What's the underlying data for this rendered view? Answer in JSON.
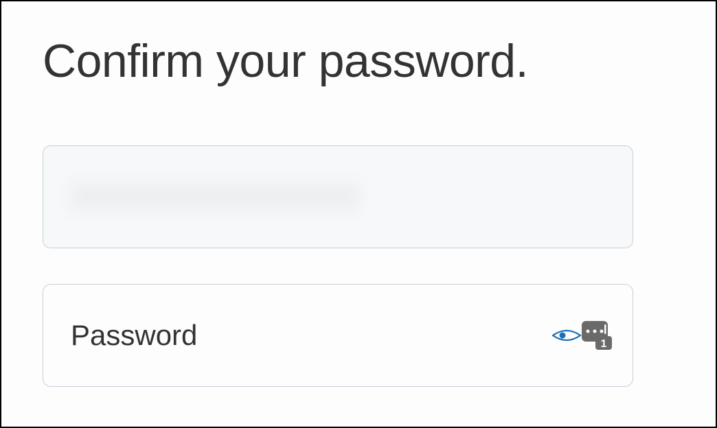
{
  "page": {
    "title": "Confirm your password."
  },
  "form": {
    "password": {
      "placeholder": "Password",
      "value": ""
    }
  },
  "icons": {
    "eye": "show-password-eye-icon",
    "pw_manager": "password-manager-icon"
  }
}
